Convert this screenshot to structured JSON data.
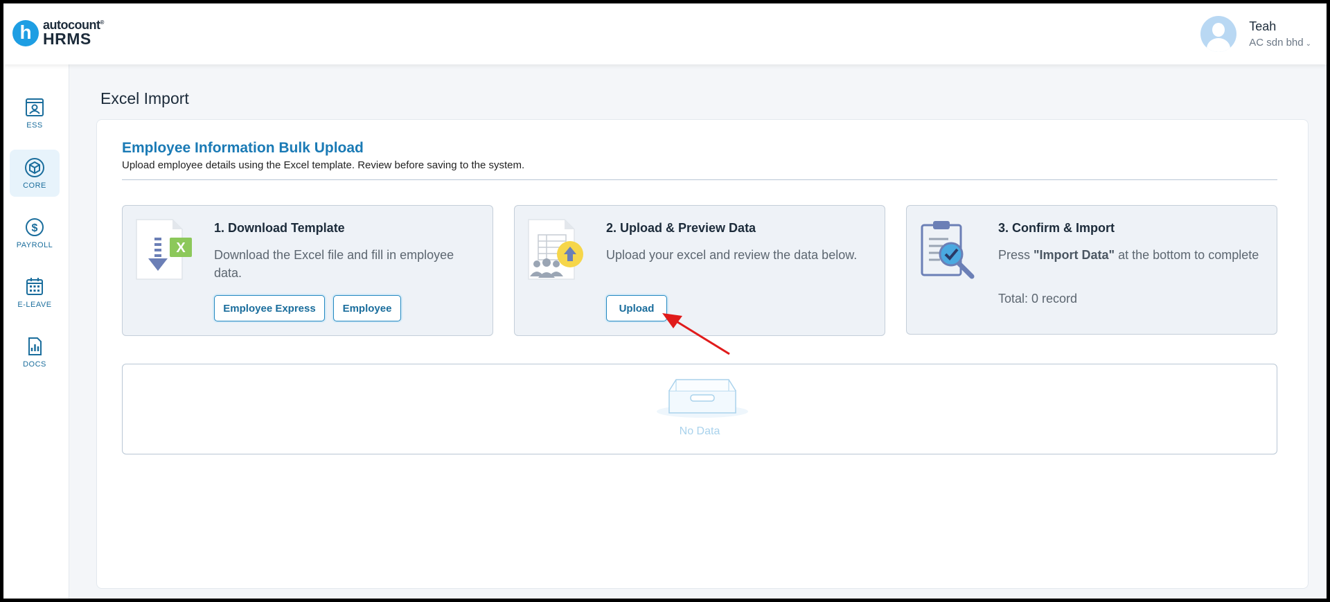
{
  "header": {
    "logo_letter": "h",
    "logo_brand": "autocount",
    "logo_tm": "®",
    "logo_product": "HRMS",
    "user_name": "Teah",
    "user_company": "AC sdn bhd",
    "company_chevron": "⌄"
  },
  "sidebar": {
    "items": [
      {
        "label": "ESS",
        "icon": "ess-id-card-icon",
        "active": false
      },
      {
        "label": "CORE",
        "icon": "cube-icon",
        "active": true
      },
      {
        "label": "PAYROLL",
        "icon": "dollar-coin-icon",
        "active": false
      },
      {
        "label": "E-LEAVE",
        "icon": "calendar-icon",
        "active": false
      },
      {
        "label": "DOCS",
        "icon": "document-chart-icon",
        "active": false
      }
    ]
  },
  "page": {
    "title": "Excel Import"
  },
  "card": {
    "title": "Employee Information Bulk Upload",
    "subtitle": "Upload employee details using the Excel template. Review before saving to the system."
  },
  "steps": [
    {
      "title": "1. Download Template",
      "description": "Download the Excel file and fill in employee data.",
      "buttons": [
        "Employee Express",
        "Employee"
      ]
    },
    {
      "title": "2. Upload & Preview Data",
      "description": "Upload your excel and review the data below.",
      "buttons": [
        "Upload"
      ]
    },
    {
      "title": "3. Confirm & Import",
      "description_prefix": "Press ",
      "description_bold": "\"Import Data\"",
      "description_suffix": " at the bottom to complete",
      "total": "Total: 0 record"
    }
  ],
  "table": {
    "empty_text": "No Data"
  },
  "colors": {
    "accent": "#1a7ab5",
    "sidebar_text": "#1a6d9c",
    "annotation_arrow": "#e01b1b"
  }
}
